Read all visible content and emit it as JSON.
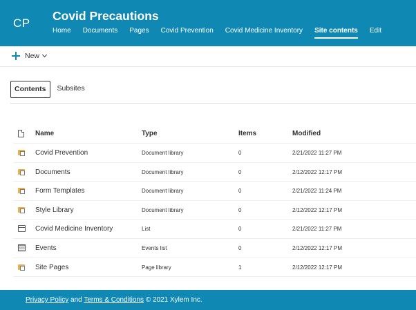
{
  "header": {
    "logo_text": "CP",
    "site_title": "Covid Precautions",
    "nav": [
      {
        "label": "Home",
        "active": false
      },
      {
        "label": "Documents",
        "active": false
      },
      {
        "label": "Pages",
        "active": false
      },
      {
        "label": "Covid Prevention",
        "active": false
      },
      {
        "label": "Covid Medicine Inventory",
        "active": false
      },
      {
        "label": "Site contents",
        "active": true
      },
      {
        "label": "Edit",
        "active": false
      }
    ]
  },
  "command_bar": {
    "new_label": "New"
  },
  "tabs": [
    {
      "label": "Contents",
      "active": true
    },
    {
      "label": "Subsites",
      "active": false
    }
  ],
  "table": {
    "columns": {
      "name": "Name",
      "type": "Type",
      "items": "Items",
      "modified": "Modified"
    },
    "rows": [
      {
        "icon": "document-library-icon",
        "name": "Covid Prevention",
        "type": "Document library",
        "items": "0",
        "modified": "2/21/2022 11:27 PM"
      },
      {
        "icon": "document-library-icon",
        "name": "Documents",
        "type": "Document library",
        "items": "0",
        "modified": "2/12/2022 12:17 PM"
      },
      {
        "icon": "document-library-icon",
        "name": "Form Templates",
        "type": "Document library",
        "items": "0",
        "modified": "2/21/2022 11:24 PM"
      },
      {
        "icon": "document-library-icon",
        "name": "Style Library",
        "type": "Document library",
        "items": "0",
        "modified": "2/12/2022 12:17 PM"
      },
      {
        "icon": "list-icon",
        "name": "Covid Medicine Inventory",
        "type": "List",
        "items": "0",
        "modified": "2/21/2022 11:27 PM"
      },
      {
        "icon": "events-list-icon",
        "name": "Events",
        "type": "Events list",
        "items": "0",
        "modified": "2/12/2022 12:17 PM"
      },
      {
        "icon": "page-library-icon",
        "name": "Site Pages",
        "type": "Page library",
        "items": "1",
        "modified": "2/12/2022 12:17 PM"
      }
    ]
  },
  "footer": {
    "privacy_label": "Privacy Policy",
    "and_text": "and",
    "terms_label": "Terms & Conditions",
    "copyright_text": "© 2021 Xylem Inc."
  },
  "colors": {
    "brand": "#0f88b4",
    "folder": "#e8b04d"
  }
}
